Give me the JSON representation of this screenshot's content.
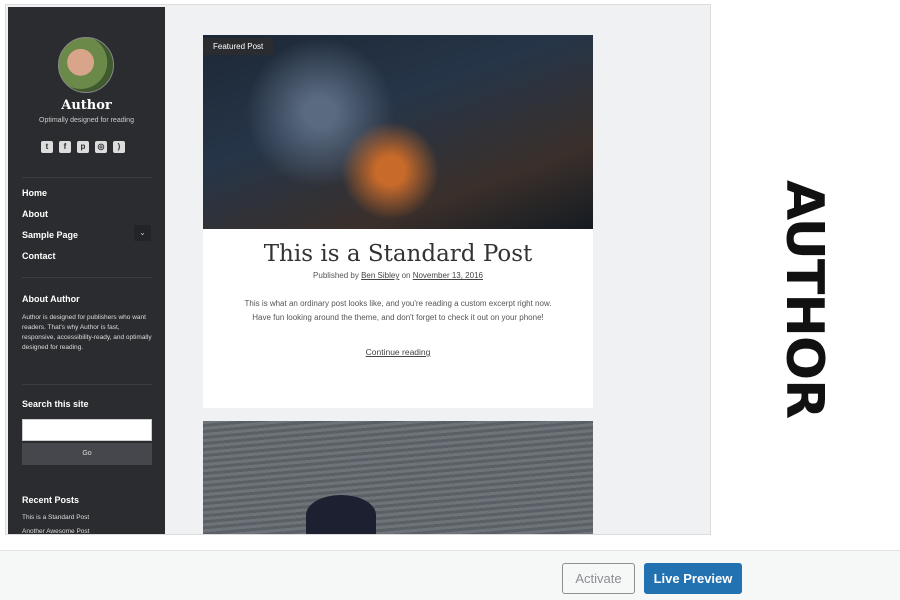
{
  "sidebar": {
    "title": "Author",
    "tagline": "Optimally designed for reading",
    "socials": [
      "twitter-icon",
      "facebook-icon",
      "pinterest-icon",
      "instagram-icon",
      "rss-icon"
    ],
    "nav": [
      "Home",
      "About",
      "Sample Page",
      "Contact"
    ],
    "about_heading": "About Author",
    "about_text": "Author is designed for publishers who want readers. That's why Author is fast, responsive, accessibility-ready, and optimally designed for reading.",
    "search_heading": "Search this site",
    "search_button": "Go",
    "recent_heading": "Recent Posts",
    "recent": [
      "This is a Standard Post",
      "Another Awesome Post"
    ]
  },
  "post": {
    "badge": "Featured Post",
    "title": "This is a Standard Post",
    "published_by": "Published by",
    "author": "Ben Sibley",
    "on": "on",
    "date": "November 13, 2016",
    "excerpt": "This is what an ordinary post looks like, and you're reading a custom excerpt right now. Have fun looking around the theme, and don't forget to check it out on your phone!",
    "continue": "Continue reading"
  },
  "theme_name": "AUTHOR",
  "actions": {
    "activate": "Activate",
    "live_preview": "Live Preview"
  },
  "colors": {
    "primary": "#2271b1",
    "sidebar": "#2b2c2f"
  }
}
